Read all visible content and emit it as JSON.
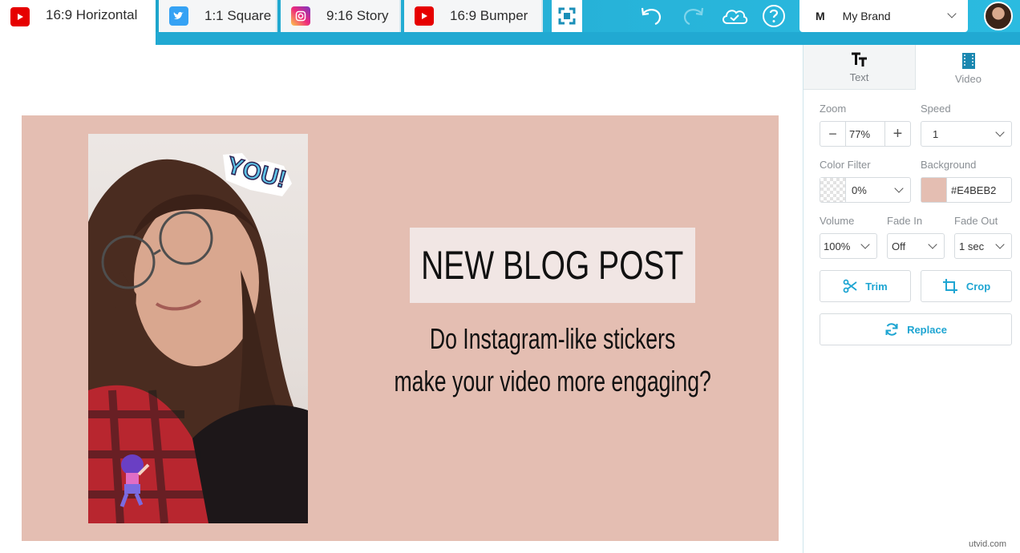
{
  "topbar": {
    "tabs": [
      {
        "label": "16:9 Horizontal",
        "icon": "youtube-icon"
      },
      {
        "label": "1:1 Square",
        "icon": "twitter-icon"
      },
      {
        "label": "9:16 Story",
        "icon": "instagram-icon"
      },
      {
        "label": "16:9 Bumper",
        "icon": "youtube-icon"
      }
    ],
    "brand": {
      "initial": "M",
      "name": "My Brand"
    }
  },
  "canvas": {
    "background": "#E4BEB2",
    "title": "NEW BLOG POST",
    "subtitle_line1": "Do Instagram-like stickers",
    "subtitle_line2": "make your video more engaging?",
    "sticker_text": "YOU!"
  },
  "panel": {
    "tabs": [
      {
        "label": "Text",
        "icon": "text-icon"
      },
      {
        "label": "Video",
        "icon": "film-icon"
      }
    ],
    "zoom": {
      "label": "Zoom",
      "value": "77%"
    },
    "speed": {
      "label": "Speed",
      "value": "1"
    },
    "color_filter": {
      "label": "Color Filter",
      "value": "0%"
    },
    "background": {
      "label": "Background",
      "value": "#E4BEB2"
    },
    "volume": {
      "label": "Volume",
      "value": "100%"
    },
    "fade_in": {
      "label": "Fade In",
      "value": "Off"
    },
    "fade_out": {
      "label": "Fade Out",
      "value": "1 sec"
    },
    "trim": "Trim",
    "crop": "Crop",
    "replace": "Replace"
  },
  "watermark": "utvid.com"
}
